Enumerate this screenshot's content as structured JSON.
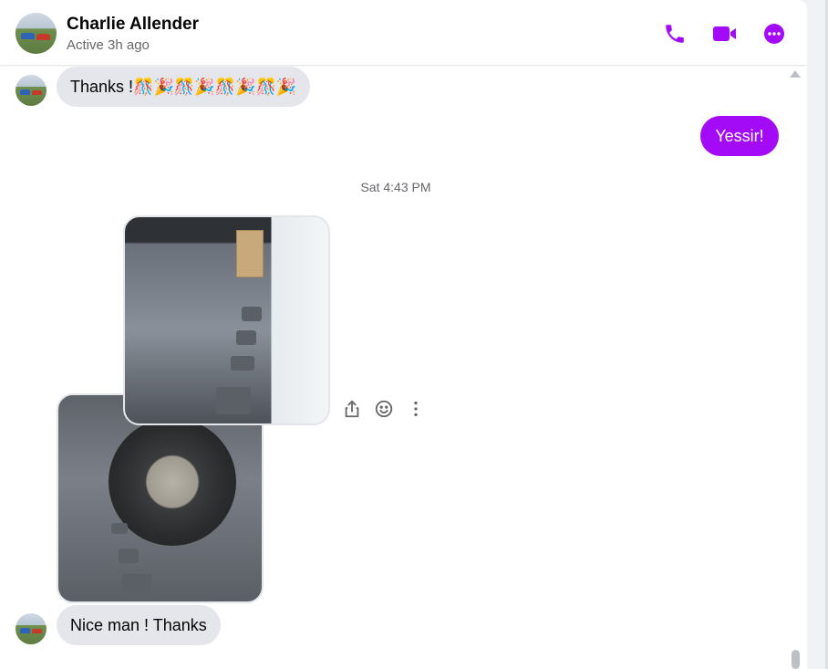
{
  "header": {
    "name": "Charlie Allender",
    "status": "Active 3h ago",
    "icons": [
      "phone-icon",
      "video-camera-icon",
      "more-options-icon"
    ]
  },
  "messages": [
    {
      "direction": "incoming",
      "text": "Thanks !🎊🎉🎊🎉🎊🎉🎊🎉"
    },
    {
      "direction": "outgoing",
      "text": "Yessir!"
    },
    {
      "type": "timestamp",
      "text": "Sat 4:43 PM"
    },
    {
      "direction": "incoming",
      "type": "photos",
      "count": 2
    },
    {
      "direction": "incoming",
      "text": "Nice man ! Thanks"
    }
  ],
  "message_actions": [
    "share-icon",
    "react-smiley-icon",
    "more-vertical-icon"
  ],
  "colors": {
    "accent": "#a30af5",
    "incoming_bubble": "#e4e6eb",
    "secondary_text": "#65676b"
  }
}
